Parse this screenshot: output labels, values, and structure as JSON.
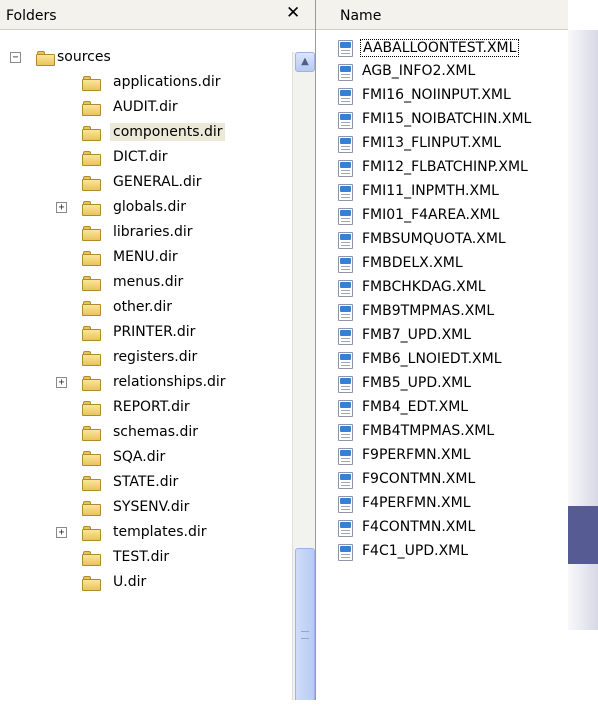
{
  "folders_pane": {
    "header_title": "Folders",
    "close_glyph": "✕",
    "tree": [
      {
        "label": "sources",
        "expander": "−",
        "level": 0
      },
      {
        "label": "applications.dir",
        "expander": "",
        "level": 1
      },
      {
        "label": "AUDIT.dir",
        "expander": "",
        "level": 1
      },
      {
        "label": "components.dir",
        "expander": "",
        "level": 1,
        "selected": true
      },
      {
        "label": "DICT.dir",
        "expander": "",
        "level": 1
      },
      {
        "label": "GENERAL.dir",
        "expander": "",
        "level": 1
      },
      {
        "label": "globals.dir",
        "expander": "+",
        "level": 1
      },
      {
        "label": "libraries.dir",
        "expander": "",
        "level": 1
      },
      {
        "label": "MENU.dir",
        "expander": "",
        "level": 1
      },
      {
        "label": "menus.dir",
        "expander": "",
        "level": 1
      },
      {
        "label": "other.dir",
        "expander": "",
        "level": 1
      },
      {
        "label": "PRINTER.dir",
        "expander": "",
        "level": 1
      },
      {
        "label": "registers.dir",
        "expander": "",
        "level": 1
      },
      {
        "label": "relationships.dir",
        "expander": "+",
        "level": 1
      },
      {
        "label": "REPORT.dir",
        "expander": "",
        "level": 1
      },
      {
        "label": "schemas.dir",
        "expander": "",
        "level": 1
      },
      {
        "label": "SQA.dir",
        "expander": "",
        "level": 1
      },
      {
        "label": "STATE.dir",
        "expander": "",
        "level": 1
      },
      {
        "label": "SYSENV.dir",
        "expander": "",
        "level": 1
      },
      {
        "label": "templates.dir",
        "expander": "+",
        "level": 1
      },
      {
        "label": "TEST.dir",
        "expander": "",
        "level": 1
      },
      {
        "label": "U.dir",
        "expander": "",
        "level": 1
      }
    ]
  },
  "files_pane": {
    "column_header": "Name",
    "files": [
      "AABALLOONTEST.XML",
      "AGB_INFO2.XML",
      "FMI16_NOIINPUT.XML",
      "FMI15_NOIBATCHIN.XML",
      "FMI13_FLINPUT.XML",
      "FMI12_FLBATCHINP.XML",
      "FMI11_INPMTH.XML",
      "FMI01_F4AREA.XML",
      "FMBSUMQUOTA.XML",
      "FMBDELX.XML",
      "FMBCHKDAG.XML",
      "FMB9TMPMAS.XML",
      "FMB7_UPD.XML",
      "FMB6_LNOIEDT.XML",
      "FMB5_UPD.XML",
      "FMB4_EDT.XML",
      "FMB4TMPMAS.XML",
      "F9PERFMN.XML",
      "F9CONTMN.XML",
      "F4PERFMN.XML",
      "F4CONTMN.XML",
      "F4C1_UPD.XML"
    ]
  },
  "colors": {
    "folder_fill": "#e8c45c",
    "xml_badge": "#3a7fd6",
    "accent_rect": "#575b93",
    "selection": "#ece9d8"
  }
}
